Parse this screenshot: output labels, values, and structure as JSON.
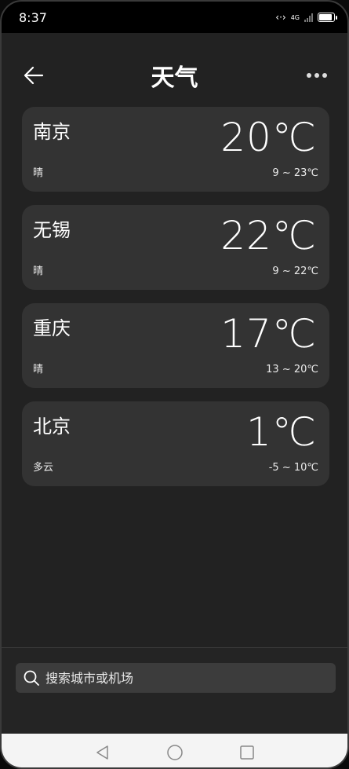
{
  "status_bar": {
    "time": "8:37",
    "network_label": "4G",
    "battery_level": 0.9
  },
  "header": {
    "title": "天气"
  },
  "cities": [
    {
      "name": "南京",
      "temp": "20℃",
      "condition": "晴",
      "range": "9 ~ 23℃"
    },
    {
      "name": "无锡",
      "temp": "22℃",
      "condition": "晴",
      "range": "9 ~ 22℃"
    },
    {
      "name": "重庆",
      "temp": "17℃",
      "condition": "晴",
      "range": "13 ~ 20℃"
    },
    {
      "name": "北京",
      "temp": "1℃",
      "condition": "多云",
      "range": "-5 ~ 10℃"
    }
  ],
  "search": {
    "placeholder": "搜索城市或机场"
  },
  "colors": {
    "background": "#222222",
    "card": "#333333",
    "search_bg": "#3c3c3c",
    "nav_bg": "#f4f4f4"
  }
}
